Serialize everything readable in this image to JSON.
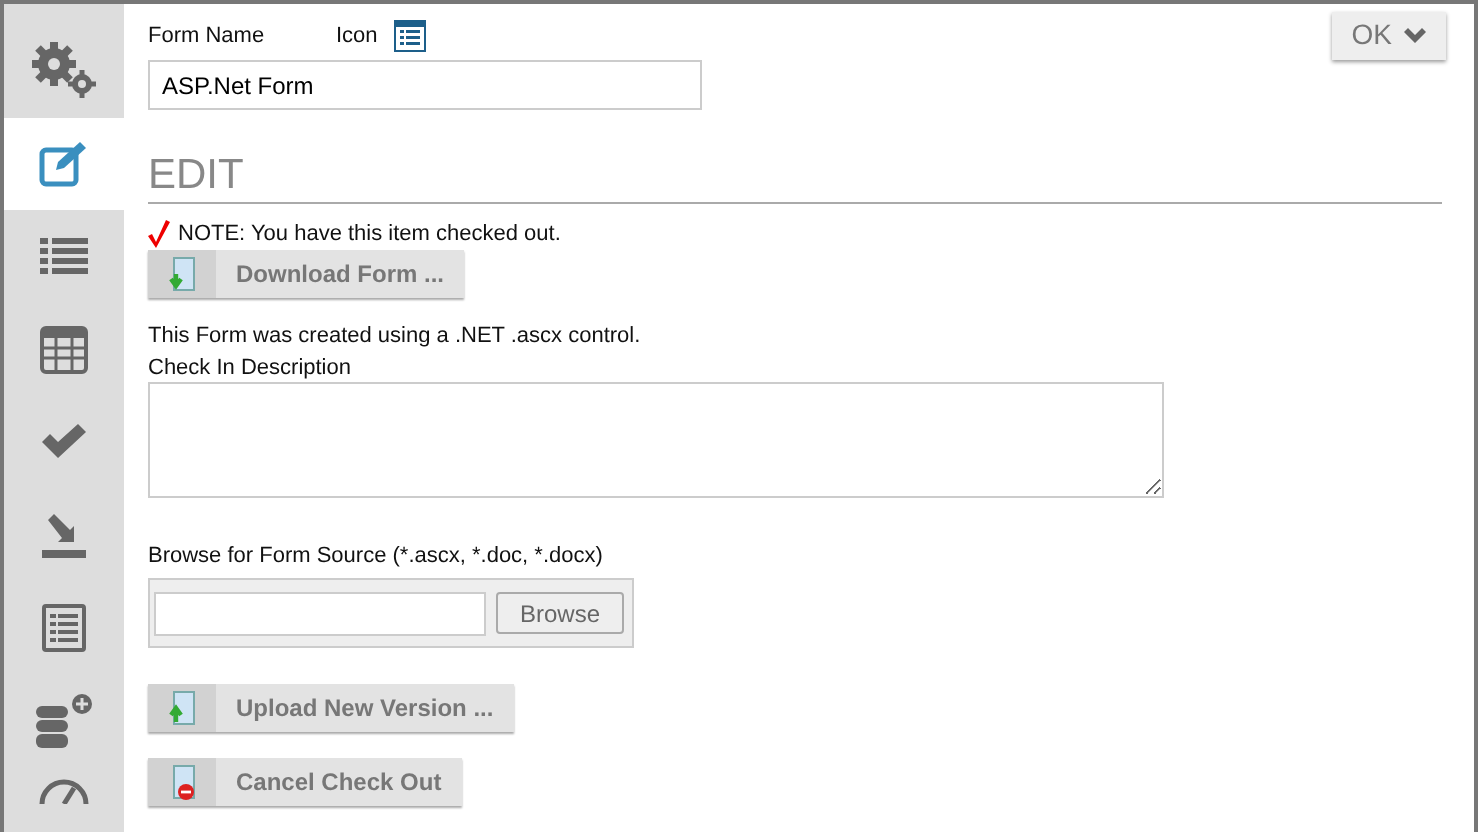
{
  "sidebar": {
    "items": [
      {
        "kind": "settings",
        "selected": false
      },
      {
        "kind": "edit",
        "selected": true
      },
      {
        "kind": "list",
        "selected": false
      },
      {
        "kind": "table",
        "selected": false
      },
      {
        "kind": "check",
        "selected": false
      },
      {
        "kind": "import",
        "selected": false
      },
      {
        "kind": "document",
        "selected": false
      },
      {
        "kind": "database",
        "selected": false
      },
      {
        "kind": "gauge",
        "selected": false
      }
    ]
  },
  "ok_button": {
    "label": "OK"
  },
  "form_name": {
    "label": "Form Name",
    "value": "ASP.Net Form"
  },
  "icon_label": "Icon",
  "section_title": "EDIT",
  "note": "NOTE: You have this item checked out.",
  "download_button": "Download Form ...",
  "info_text": "This Form was created using a .NET .ascx control.",
  "description": {
    "label": "Check In Description"
  },
  "browse": {
    "label": "Browse for Form Source (*.ascx, *.doc, *.docx)",
    "button": "Browse"
  },
  "actions": [
    {
      "kind": "upload",
      "label": "Upload New Version ..."
    },
    {
      "kind": "cancel",
      "label": "Cancel Check Out"
    }
  ]
}
